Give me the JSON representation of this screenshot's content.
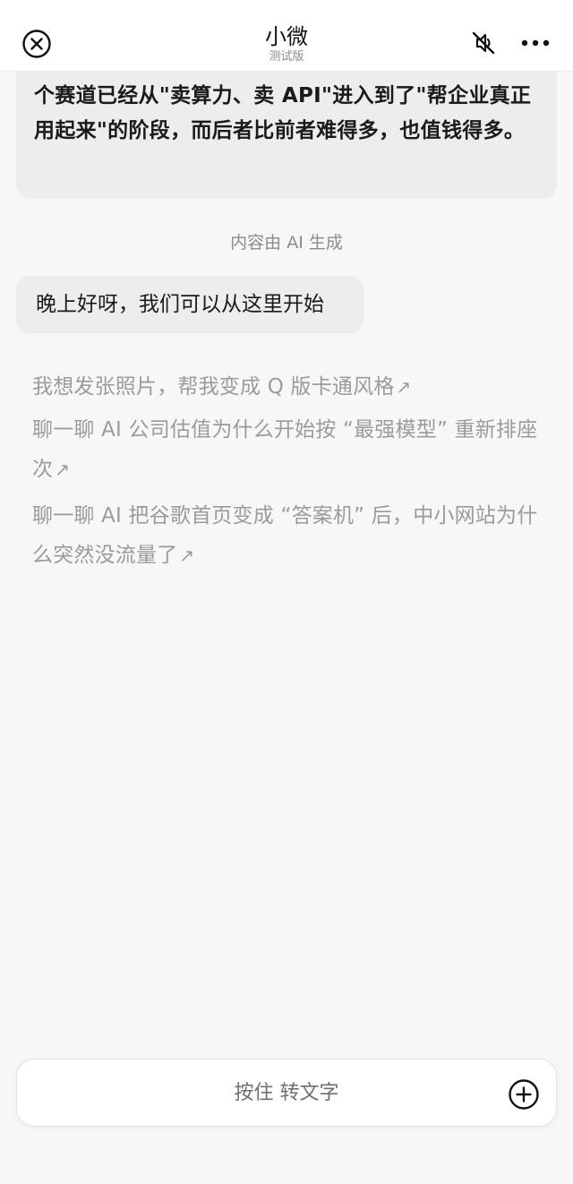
{
  "header": {
    "title": "小微",
    "subtitle": "测试版",
    "icons": {
      "close": "close-circle-icon",
      "mute": "mute-icon",
      "more": "more-icon"
    }
  },
  "messages": {
    "previous_bubble_text": "个赛道已经从\"卖算力、卖 API\"进入到了\"帮企业真正用起来\"的阶段，而后者比前者难得多，也值钱得多。",
    "ai_notice": "内容由 AI 生成",
    "greeting": "晚上好呀，我们可以从这里开始"
  },
  "suggestions": [
    {
      "text": "我想发张照片，帮我变成 Q 版卡通风格",
      "icon": "arrow-up-right-icon"
    },
    {
      "text": "聊一聊 AI 公司估值为什么开始按 “最强模型” 重新排座次",
      "icon": "arrow-up-right-icon"
    },
    {
      "text": "聊一聊 AI 把谷歌首页变成 “答案机” 后，中小网站为什么突然没流量了",
      "icon": "arrow-up-right-icon"
    }
  ],
  "input": {
    "hold_label": "按住 转文字",
    "plus_icon": "plus-circle-icon"
  },
  "colors": {
    "background": "#f7f7f8",
    "bubble": "#ededef",
    "suggestion_text": "#9b9b9d",
    "header_bg": "#ffffff"
  }
}
